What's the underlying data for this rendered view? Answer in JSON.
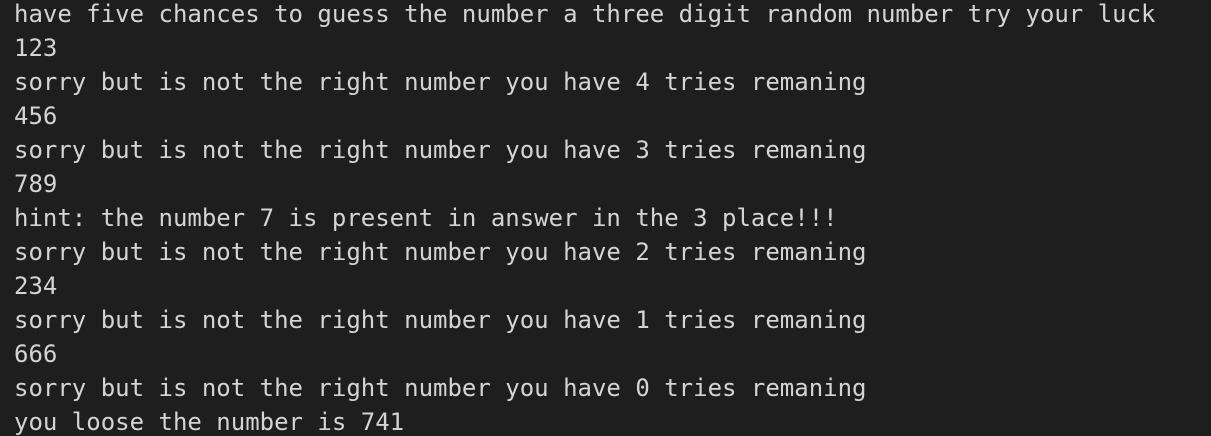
{
  "terminal": {
    "lines": [
      "have five chances to guess the number a three digit random number try your luck",
      "123",
      "sorry but is not the right number you have 4 tries remaning",
      "456",
      "sorry but is not the right number you have 3 tries remaning",
      "789",
      "hint: the number 7 is present in answer in the 3 place!!!",
      "sorry but is not the right number you have 2 tries remaning",
      "234",
      "sorry but is not the right number you have 1 tries remaning",
      "666",
      "sorry but is not the right number you have 0 tries remaning",
      "you loose the number is 741"
    ]
  },
  "colors": {
    "background": "#1e1e1e",
    "text": "#d4d4d4"
  }
}
